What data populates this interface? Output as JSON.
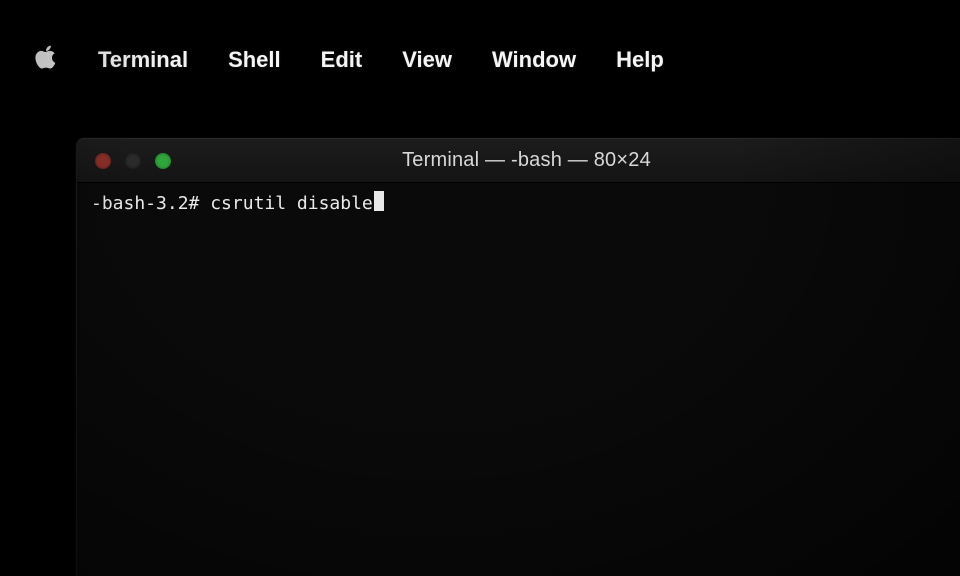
{
  "menubar": {
    "items": [
      "Terminal",
      "Shell",
      "Edit",
      "View",
      "Window",
      "Help"
    ]
  },
  "window": {
    "title": "Terminal — -bash — 80×24"
  },
  "terminal": {
    "prompt": "-bash-3.2# ",
    "command": "csrutil disable"
  }
}
